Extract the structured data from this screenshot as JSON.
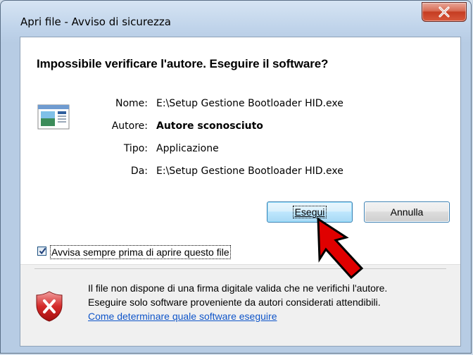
{
  "window": {
    "title": "Apri file - Avviso di sicurezza",
    "close_label": "X"
  },
  "dialog": {
    "heading": "Impossibile verificare l'autore. Eseguire il software?",
    "fields": [
      {
        "label": "Nome:",
        "value": "E:\\Setup Gestione Bootloader HID.exe"
      },
      {
        "label": "Autore:",
        "value": "Autore sconosciuto"
      },
      {
        "label": "Tipo:",
        "value": "Applicazione"
      },
      {
        "label": "Da:",
        "value": "E:\\Setup Gestione Bootloader HID.exe"
      }
    ],
    "buttons": {
      "run": "Esegui",
      "cancel": "Annulla"
    },
    "checkbox": {
      "label": "Avvisa sempre prima di aprire questo file",
      "checked": true
    },
    "footer": {
      "line1": "Il file non dispone di una firma digitale valida che ne verifichi l'autore.",
      "line2": "Eseguire solo software proveniente da autori considerati attendibili.",
      "link": "Come determinare quale software eseguire"
    }
  },
  "colors": {
    "link": "#0f55c9",
    "arrow": "#e00000",
    "close_button": "#c53d22"
  },
  "icons": [
    "application-icon",
    "close-icon",
    "shield-warning-icon",
    "red-arrow-icon",
    "checkmark-icon"
  ]
}
